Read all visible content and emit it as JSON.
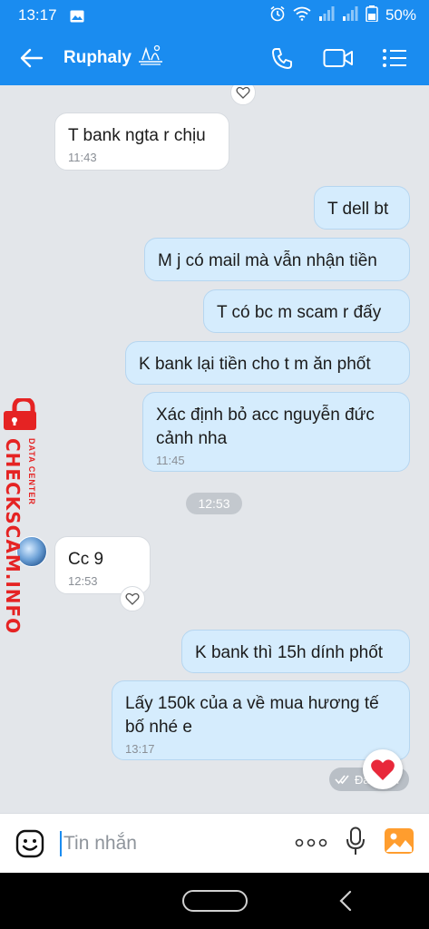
{
  "status_bar": {
    "time": "13:17",
    "battery": "50%"
  },
  "header": {
    "contact_name": "Ruphaly"
  },
  "messages": [
    {
      "id": "m1",
      "dir": "in",
      "text": "T bank ngta r chịu",
      "time": "11:43"
    },
    {
      "id": "m2",
      "dir": "out",
      "text": "T dell bt"
    },
    {
      "id": "m3",
      "dir": "out",
      "text": "M j có mail mà vẫn nhận tiền"
    },
    {
      "id": "m4",
      "dir": "out",
      "text": "T có bc m scam r đấy"
    },
    {
      "id": "m5",
      "dir": "out",
      "text": "K bank lại tiền cho t m ăn phốt"
    },
    {
      "id": "m6",
      "dir": "out",
      "line1": "Xác định bỏ acc nguyễn đức",
      "line2": "cảnh nha",
      "time": "11:45"
    },
    {
      "id": "m7",
      "dir": "in",
      "text": "Cc 9",
      "time": "12:53"
    },
    {
      "id": "m8",
      "dir": "out",
      "text": "K bank thì 15h dính phốt"
    },
    {
      "id": "m9",
      "dir": "out",
      "line1": "Lấy 150k của a về mua hương tế",
      "line2": "bố nhé e",
      "time": "13:17"
    }
  ],
  "separator_time": "12:53",
  "delivery_status": "Đã nhận",
  "watermark": {
    "brand": "CHECKSCAM.INFO",
    "sub": "DATA CENTER"
  },
  "composer": {
    "placeholder": "Tin nhắn",
    "more": "ooo"
  },
  "colors": {
    "header": "#1a8cf0",
    "bubble_out": "#d5ecfd",
    "bubble_in": "#ffffff",
    "watermark": "#e52323"
  }
}
